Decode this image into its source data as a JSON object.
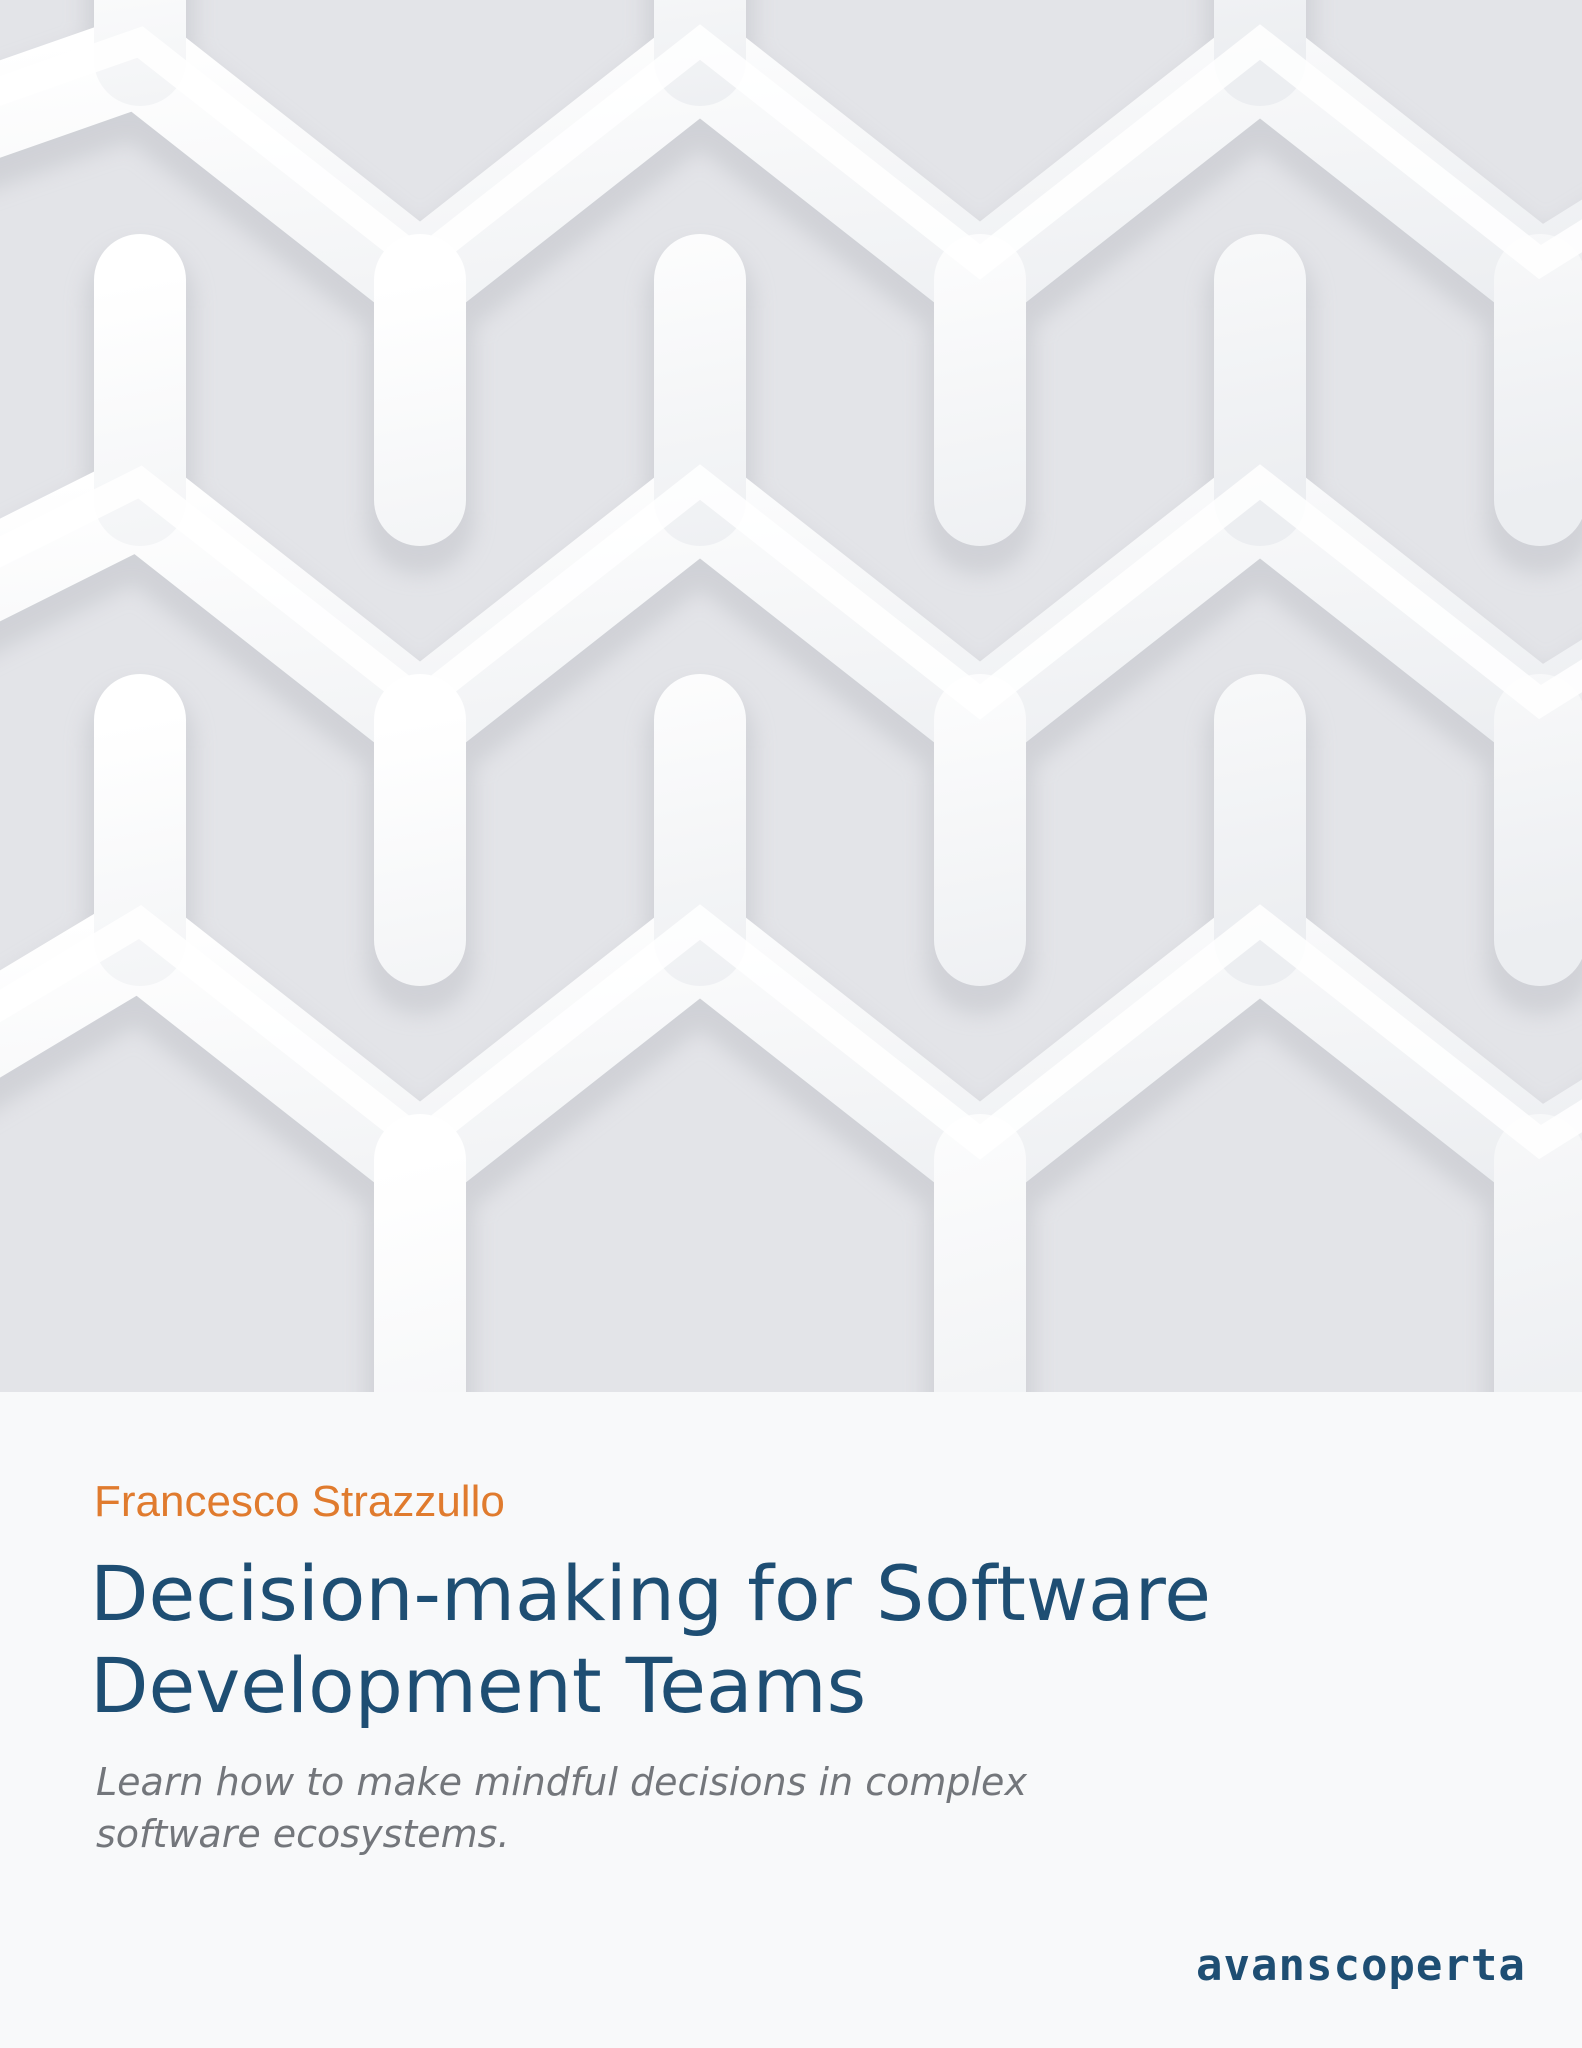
{
  "cover": {
    "author": "Francesco Strazzullo",
    "title_lines": [
      "Decision-making for Software",
      "Development Teams"
    ],
    "subtitle_lines": [
      "Learn how to make mindful decisions in complex",
      "software ecosystems."
    ],
    "publisher": "avanscoperta"
  },
  "colors": {
    "author": "#e07b2e",
    "title": "#1e4e73",
    "subtitle": "#73767b",
    "publisher": "#1e4e73",
    "background": "#f8f9fa",
    "image_shade": "#dedfe3"
  },
  "image": {
    "description_icon": "white-lattice-image"
  }
}
